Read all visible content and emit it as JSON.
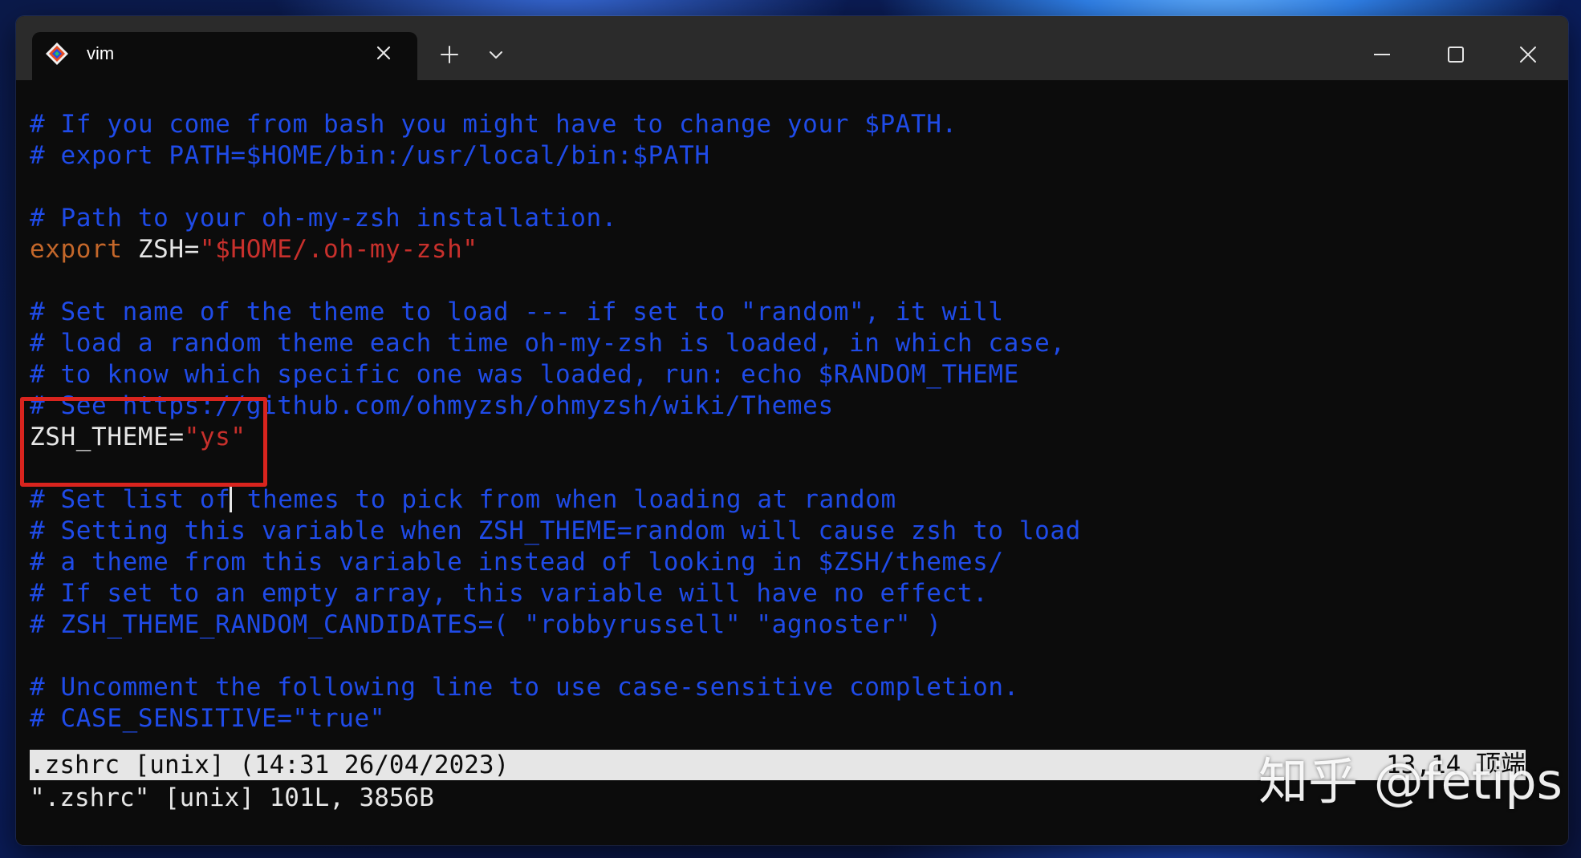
{
  "tab": {
    "title": "vim",
    "icon": "git-bash-icon",
    "close_icon": "close-icon"
  },
  "titlebar": {
    "new_tab_icon": "plus-icon",
    "dropdown_icon": "chevron-down-icon",
    "minimize_icon": "minimize-icon",
    "maximize_icon": "maximize-icon",
    "close_icon": "close-icon"
  },
  "colors": {
    "comment": "#1f4be8",
    "keyword": "#c4672a",
    "string": "#c8302c",
    "plain": "#e6e6e6",
    "background": "#0c0c0c",
    "highlight_box": "#d9241e"
  },
  "editor": {
    "lines": [
      [
        {
          "t": "comment",
          "s": "# If you come from bash you might have to change your $PATH."
        }
      ],
      [
        {
          "t": "comment",
          "s": "# export PATH=$HOME/bin:/usr/local/bin:$PATH"
        }
      ],
      [],
      [
        {
          "t": "comment",
          "s": "# Path to your oh-my-zsh installation."
        }
      ],
      [
        {
          "t": "keyword",
          "s": "export"
        },
        {
          "t": "plain",
          "s": " ZSH="
        },
        {
          "t": "string",
          "s": "\"$HOME/.oh-my-zsh\""
        }
      ],
      [],
      [
        {
          "t": "comment",
          "s": "# Set name of the theme to load --- if set to \"random\", it will"
        }
      ],
      [
        {
          "t": "comment",
          "s": "# load a random theme each time oh-my-zsh is loaded, in which case,"
        }
      ],
      [
        {
          "t": "comment",
          "s": "# to know which specific one was loaded, run: echo $RANDOM_THEME"
        }
      ],
      [
        {
          "t": "comment",
          "s": "# See https://github.com/ohmyzsh/ohmyzsh/wiki/Themes"
        }
      ],
      [
        {
          "t": "plain",
          "s": "ZSH_THEME="
        },
        {
          "t": "string",
          "s": "\"ys\""
        }
      ],
      [],
      [
        {
          "t": "comment",
          "s": "# Set list of"
        },
        {
          "t": "cursor",
          "s": ""
        },
        {
          "t": "comment",
          "s": " themes to pick from when loading at random"
        }
      ],
      [
        {
          "t": "comment",
          "s": "# Setting this variable when ZSH_THEME=random will cause zsh to load"
        }
      ],
      [
        {
          "t": "comment",
          "s": "# a theme from this variable instead of looking in $ZSH/themes/"
        }
      ],
      [
        {
          "t": "comment",
          "s": "# If set to an empty array, this variable will have no effect."
        }
      ],
      [
        {
          "t": "comment",
          "s": "# ZSH_THEME_RANDOM_CANDIDATES=( \"robbyrussell\" \"agnoster\" )"
        }
      ],
      [],
      [
        {
          "t": "comment",
          "s": "# Uncomment the following line to use case-sensitive completion."
        }
      ],
      [
        {
          "t": "comment",
          "s": "# CASE_SENSITIVE=\"true\""
        }
      ]
    ]
  },
  "statusline": {
    "file_info": ".zshrc [unix] (14:31 26/04/2023)",
    "position": "13,14 顶端"
  },
  "cmdline": {
    "message": "\".zshrc\" [unix] 101L, 3856B"
  },
  "watermark": {
    "text": "知乎 @fetips"
  }
}
